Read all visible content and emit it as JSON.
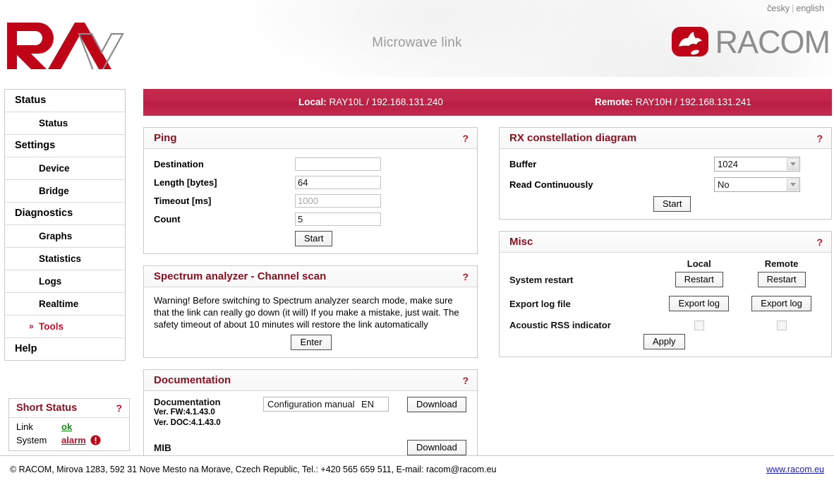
{
  "header": {
    "lang_cs": "česky",
    "lang_sep": "|",
    "lang_en": "english",
    "product_title": "Microwave link",
    "brand_ray": "RAy",
    "brand_racom": "RACOM"
  },
  "sidebar": {
    "items": [
      {
        "label": "Status",
        "level": "group",
        "active": false
      },
      {
        "label": "Status",
        "level": "sub",
        "active": false
      },
      {
        "label": "Settings",
        "level": "group",
        "active": false
      },
      {
        "label": "Device",
        "level": "sub",
        "active": false
      },
      {
        "label": "Bridge",
        "level": "sub",
        "active": false
      },
      {
        "label": "Diagnostics",
        "level": "group",
        "active": false
      },
      {
        "label": "Graphs",
        "level": "sub",
        "active": false
      },
      {
        "label": "Statistics",
        "level": "sub",
        "active": false
      },
      {
        "label": "Logs",
        "level": "sub",
        "active": false
      },
      {
        "label": "Realtime",
        "level": "sub",
        "active": false
      },
      {
        "label": "Tools",
        "level": "sub",
        "active": true
      },
      {
        "label": "Help",
        "level": "group",
        "active": false
      }
    ],
    "short_status": {
      "title": "Short Status",
      "help": "?",
      "rows": [
        {
          "label": "Link",
          "value": "ok",
          "state": "ok"
        },
        {
          "label": "System",
          "value": "alarm",
          "state": "alarm"
        }
      ]
    }
  },
  "banner": {
    "local_label": "Local:",
    "local_value": "RAY10L / 192.168.131.240",
    "remote_label": "Remote:",
    "remote_value": "RAY10H / 192.168.131.241"
  },
  "ping": {
    "title": "Ping",
    "help": "?",
    "destination_label": "Destination",
    "destination_value": "",
    "length_label": "Length [bytes]",
    "length_value": "64",
    "timeout_label": "Timeout [ms]",
    "timeout_placeholder": "1000",
    "count_label": "Count",
    "count_value": "5",
    "start_label": "Start"
  },
  "spectrum": {
    "title": "Spectrum analyzer - Channel scan",
    "help": "?",
    "warning": "Warning! Before switching to Spectrum analyzer search mode, make sure that the link can really go down (it will) If you make a mistake, just wait. The safety timeout of about 10 minutes will restore the link automatically",
    "enter_label": "Enter"
  },
  "documentation": {
    "title": "Documentation",
    "help": "?",
    "row_label": "Documentation",
    "selected": "Configuration manual",
    "lang": "EN",
    "fw_version": "Ver. FW:4.1.43.0",
    "doc_version": "Ver. DOC:4.1.43.0",
    "download_label": "Download",
    "mib_label": "MIB",
    "mib_download_label": "Download"
  },
  "rx_constellation": {
    "title": "RX constellation diagram",
    "help": "?",
    "buffer_label": "Buffer",
    "buffer_value": "1024",
    "read_label": "Read Continuously",
    "read_value": "No",
    "start_label": "Start"
  },
  "misc": {
    "title": "Misc",
    "help": "?",
    "col_local": "Local",
    "col_remote": "Remote",
    "restart_label": "System restart",
    "restart_btn_local": "Restart",
    "restart_btn_remote": "Restart",
    "export_label": "Export log file",
    "export_btn_local": "Export log",
    "export_btn_remote": "Export log",
    "acoustic_label": "Acoustic RSS indicator",
    "apply_label": "Apply"
  },
  "footer": {
    "copyright": "© RACOM, Mirova 1283, 592 31 Nove Mesto na Morave, Czech Republic, Tel.: +420 565 659 511, E-mail: racom@racom.eu",
    "site": "www.racom.eu"
  },
  "colors": {
    "brand_red": "#c0112d",
    "banner_red": "#c5294e",
    "panel_title": "#8c1020",
    "ok_green": "#1a8a1a",
    "gray_text": "#9a9a9a"
  }
}
